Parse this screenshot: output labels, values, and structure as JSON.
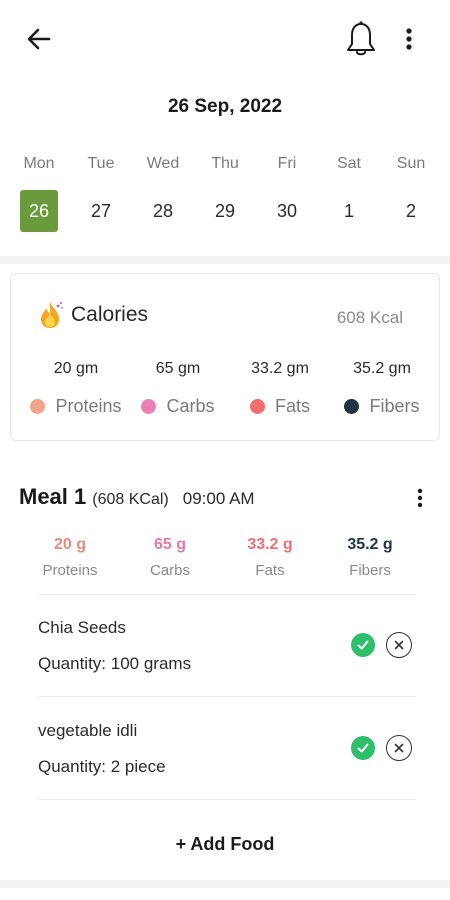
{
  "header": {
    "back_icon": "arrow-left-icon",
    "bell_icon": "bell-icon",
    "menu_icon": "more-vertical-icon"
  },
  "date_title": "26 Sep, 2022",
  "week": [
    {
      "name": "Mon",
      "num": "26",
      "active": true
    },
    {
      "name": "Tue",
      "num": "27"
    },
    {
      "name": "Wed",
      "num": "28"
    },
    {
      "name": "Thu",
      "num": "29"
    },
    {
      "name": "Fri",
      "num": "30"
    },
    {
      "name": "Sat",
      "num": "1"
    },
    {
      "name": "Sun",
      "num": "2"
    }
  ],
  "calories": {
    "icon": "fire-icon",
    "title": "Calories",
    "total": "608 Kcal",
    "nutrients": [
      {
        "value": "20 gm",
        "label": "Proteins",
        "color": "#f0a58a"
      },
      {
        "value": "65 gm",
        "label": "Carbs",
        "color": "#ec7fb6"
      },
      {
        "value": "33.2 gm",
        "label": "Fats",
        "color": "#f06e6e"
      },
      {
        "value": "35.2 gm",
        "label": "Fibers",
        "color": "#1f3347"
      }
    ]
  },
  "meal": {
    "title": "Meal 1",
    "kcal": "(608 KCal)",
    "time": "09:00 AM",
    "macros": [
      {
        "value": "20 g",
        "label": "Proteins",
        "color": "#e88a7c"
      },
      {
        "value": "65 g",
        "label": "Carbs",
        "color": "#e37aa9"
      },
      {
        "value": "33.2 g",
        "label": "Fats",
        "color": "#ee6f74"
      },
      {
        "value": "35.2 g",
        "label": "Fibers",
        "color": "#21344a"
      }
    ],
    "foods": [
      {
        "name": "Chia Seeds",
        "quantity": "Quantity: 100 grams"
      },
      {
        "name": "vegetable idli",
        "quantity": "Quantity: 2 piece"
      }
    ],
    "add_food_label": "+ Add Food"
  },
  "colors": {
    "accent": "#6a9a3b",
    "check": "#2fbf6b"
  }
}
